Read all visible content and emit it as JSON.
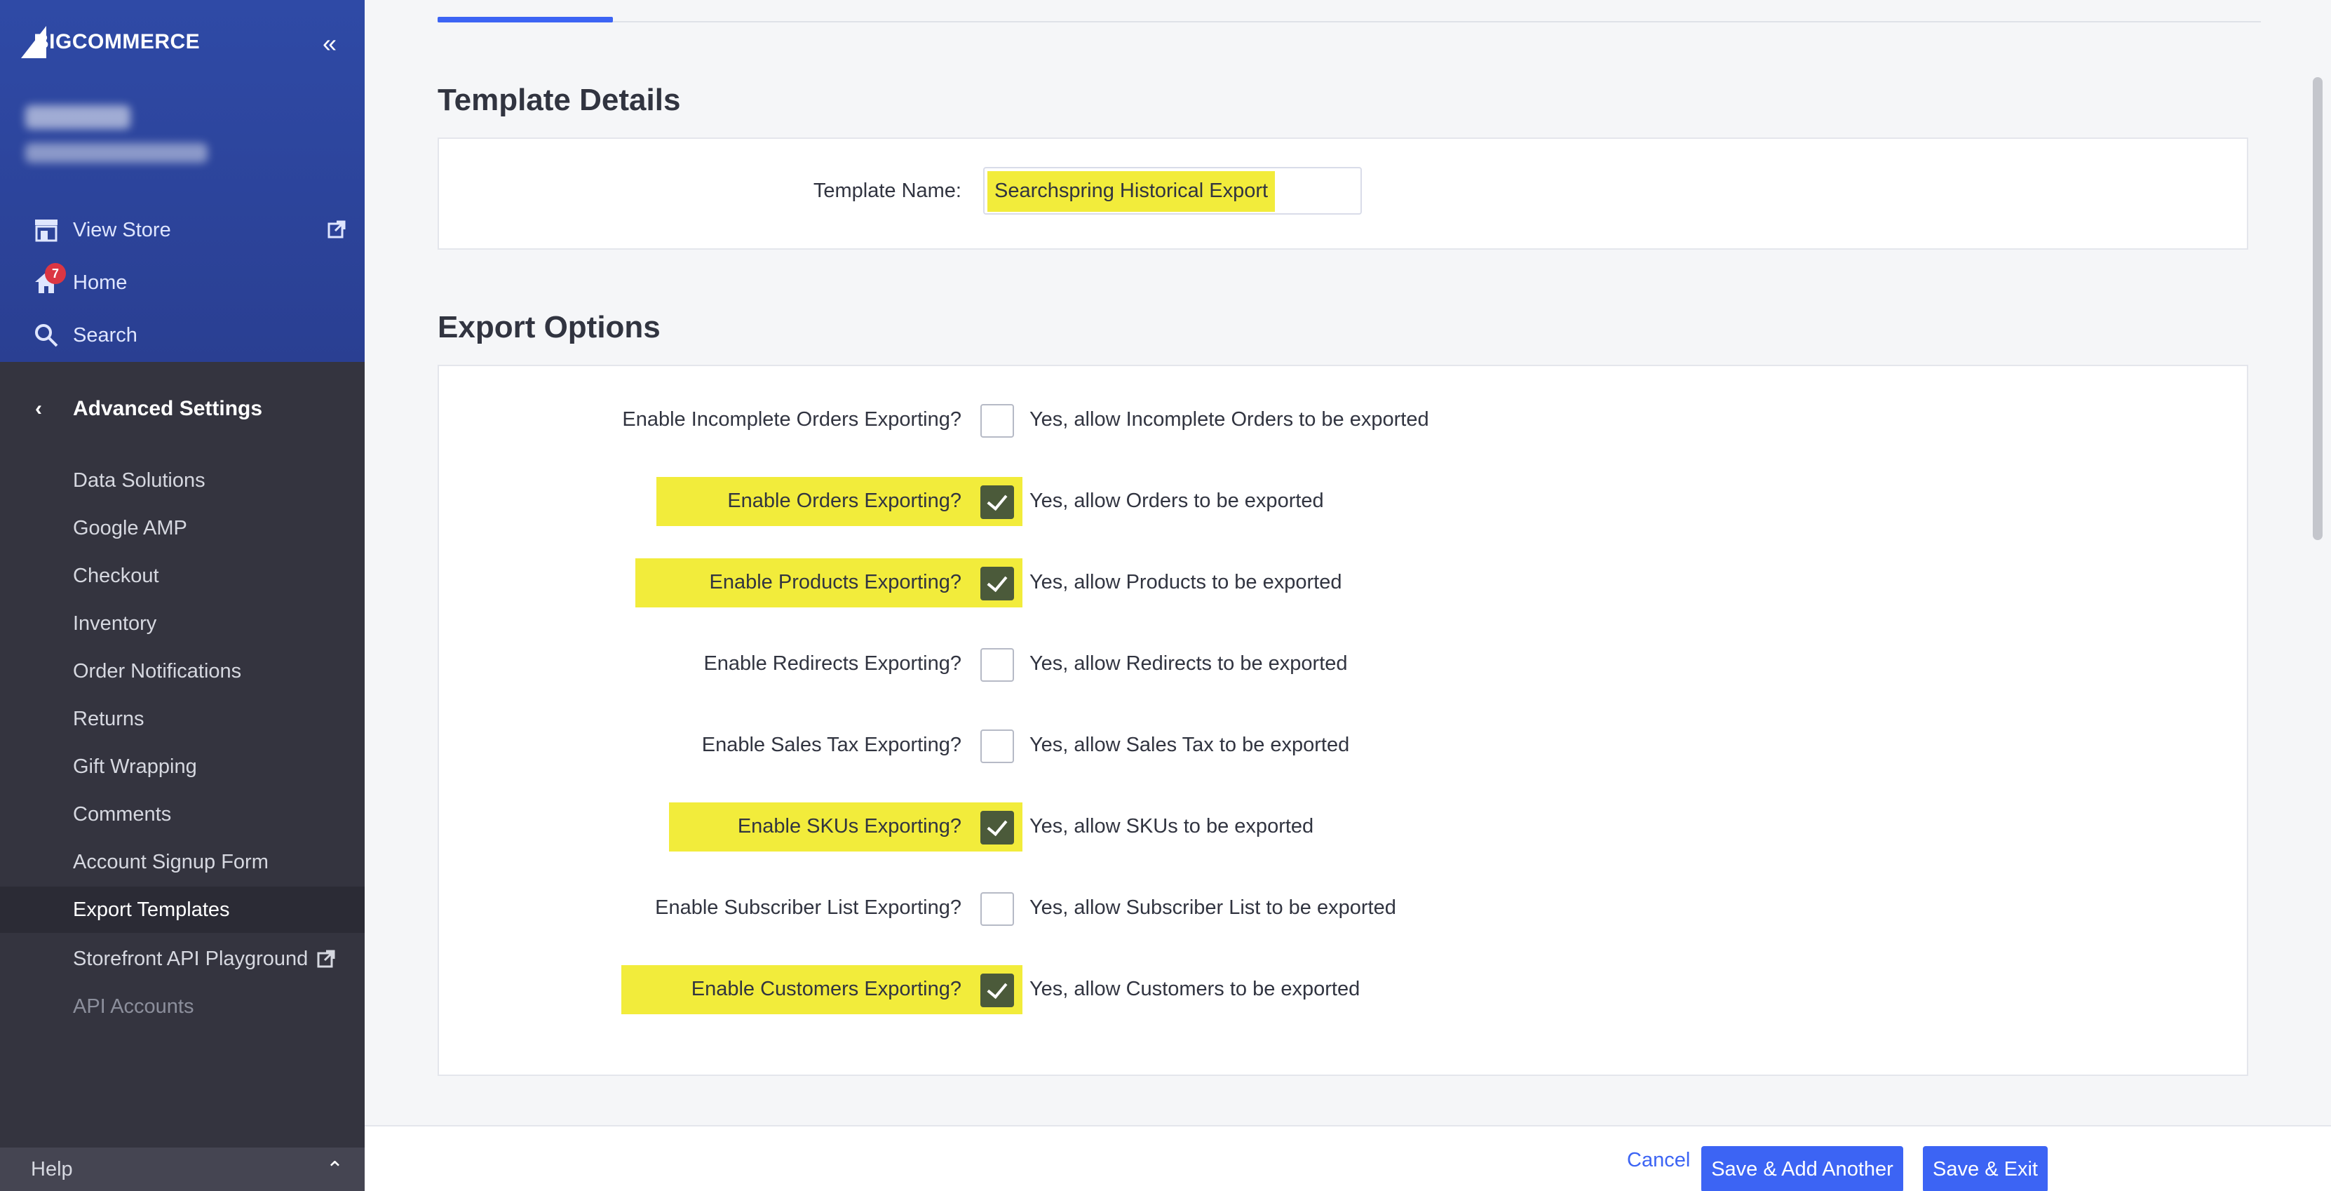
{
  "brand": {
    "logo_text": "BIGCOMMERCE"
  },
  "sidebar": {
    "collapse_label": "«",
    "top_items": [
      {
        "label": "View Store",
        "icon": "store-icon"
      },
      {
        "label": "Home",
        "icon": "home-icon",
        "badge": "7"
      },
      {
        "label": "Search",
        "icon": "search-icon"
      }
    ],
    "section": {
      "label": "Advanced Settings",
      "back_icon": "‹"
    },
    "items": [
      {
        "label": "Data Solutions"
      },
      {
        "label": "Google AMP"
      },
      {
        "label": "Checkout"
      },
      {
        "label": "Inventory"
      },
      {
        "label": "Order Notifications"
      },
      {
        "label": "Returns"
      },
      {
        "label": "Gift Wrapping"
      },
      {
        "label": "Comments"
      },
      {
        "label": "Account Signup Form"
      },
      {
        "label": "Export Templates"
      },
      {
        "label": "Storefront API Playground"
      },
      {
        "label": "API Accounts"
      }
    ],
    "help": {
      "label": "Help",
      "caret": "⌃"
    }
  },
  "template_details": {
    "title": "Template Details",
    "name_label": "Template Name:",
    "name_value": "Searchspring Historical Export"
  },
  "export_options": {
    "title": "Export Options",
    "options": [
      {
        "label": "Enable Incomplete Orders Exporting?",
        "desc": "Yes, allow Incomplete Orders to be exported",
        "checked": false
      },
      {
        "label": "Enable Orders Exporting?",
        "desc": "Yes, allow Orders to be exported",
        "checked": true
      },
      {
        "label": "Enable Products Exporting?",
        "desc": "Yes, allow Products to be exported",
        "checked": true
      },
      {
        "label": "Enable Redirects Exporting?",
        "desc": "Yes, allow Redirects to be exported",
        "checked": false
      },
      {
        "label": "Enable Sales Tax Exporting?",
        "desc": "Yes, allow Sales Tax to be exported",
        "checked": false
      },
      {
        "label": "Enable SKUs Exporting?",
        "desc": "Yes, allow SKUs to be exported",
        "checked": true
      },
      {
        "label": "Enable Subscriber List Exporting?",
        "desc": "Yes, allow Subscriber List to be exported",
        "checked": false
      },
      {
        "label": "Enable Customers Exporting?",
        "desc": "Yes, allow Customers to be exported",
        "checked": true
      }
    ]
  },
  "footer": {
    "cancel": "Cancel",
    "save_add": "Save & Add Another",
    "save_exit": "Save & Exit"
  },
  "colors": {
    "sidebar_top": "#2f4aa6",
    "sidebar": "#34343f",
    "accent": "#3c64f4",
    "highlight": "#f2ec3b",
    "checkbox_checked": "#4b5a3a"
  }
}
